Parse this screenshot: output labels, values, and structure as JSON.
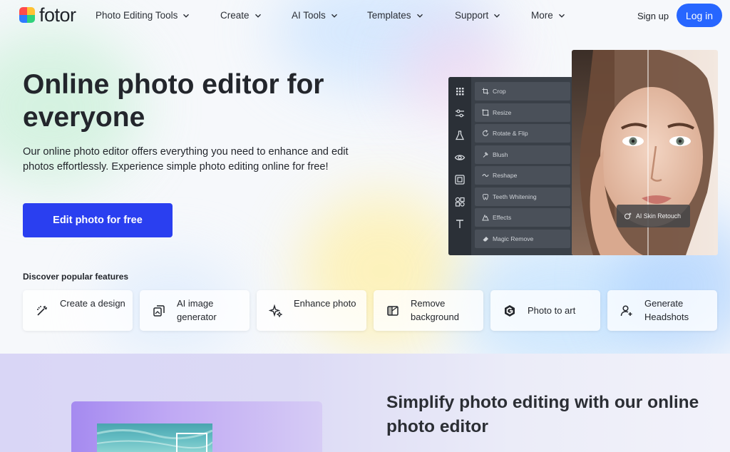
{
  "brand": {
    "name": "fotor"
  },
  "nav": {
    "items": [
      {
        "label": "Photo Editing Tools"
      },
      {
        "label": "Create"
      },
      {
        "label": "AI Tools"
      },
      {
        "label": "Templates"
      },
      {
        "label": "Support"
      },
      {
        "label": "More"
      }
    ],
    "signup": "Sign up",
    "login": "Log in"
  },
  "hero": {
    "title": "Online photo editor for everyone",
    "description": "Our online photo editor offers everything you need to enhance and edit photos effortlessly. Experience simple photo editing online for free!",
    "cta": "Edit photo for free"
  },
  "features": {
    "heading": "Discover popular features",
    "items": [
      {
        "label": "Create a design",
        "icon": "magic-wand-icon"
      },
      {
        "label": "AI image generator",
        "icon": "ai-image-icon"
      },
      {
        "label": "Enhance photo",
        "icon": "sparkle-icon"
      },
      {
        "label": "Remove background",
        "icon": "remove-bg-icon"
      },
      {
        "label": "Photo to art",
        "icon": "art-logo-icon"
      },
      {
        "label": "Generate Headshots",
        "icon": "headshot-icon"
      }
    ]
  },
  "editor_mock": {
    "tools": [
      {
        "label": "Crop",
        "icon": "crop-icon"
      },
      {
        "label": "Resize",
        "icon": "resize-icon"
      },
      {
        "label": "Rotate & Flip",
        "icon": "rotate-icon"
      },
      {
        "label": "Blush",
        "icon": "blush-icon"
      },
      {
        "label": "Reshape",
        "icon": "reshape-icon"
      },
      {
        "label": "Teeth Whitening",
        "icon": "teeth-icon"
      },
      {
        "label": "Effects",
        "icon": "effects-icon"
      },
      {
        "label": "Magic Remove",
        "icon": "eraser-icon"
      }
    ],
    "badge": "AI Skin Retouch"
  },
  "section2": {
    "title": "Simplify photo editing with our online photo editor"
  },
  "colors": {
    "accent": "#2766ff",
    "cta": "#2a3ff0"
  }
}
